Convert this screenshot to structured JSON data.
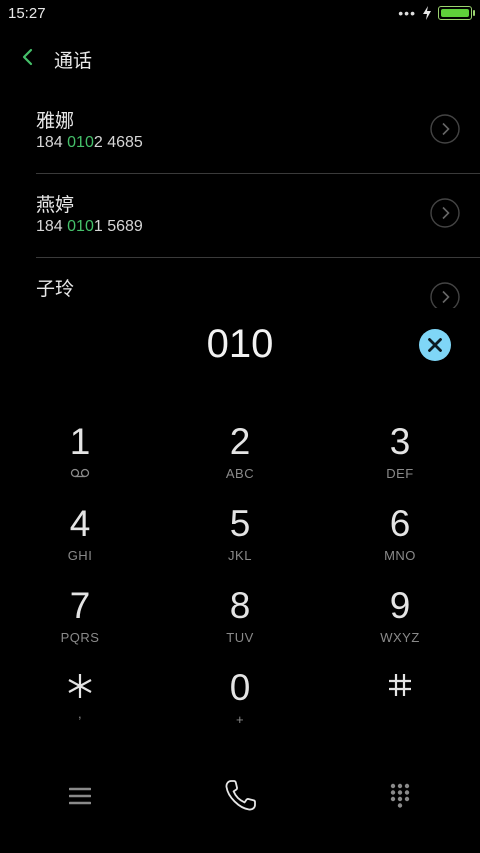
{
  "status_bar": {
    "time": "15:27",
    "dots": "•••",
    "battery_level": 1.0,
    "battery_color": "#5fd13a"
  },
  "header": {
    "title": "通话",
    "accent": "#45c06a"
  },
  "contacts": [
    {
      "name": "雅娜",
      "number_prefix": "184 ",
      "number_match": "010",
      "number_suffix": "2 4685"
    },
    {
      "name": "燕婷",
      "number_prefix": "184 ",
      "number_match": "010",
      "number_suffix": "1 5689"
    },
    {
      "name": "子玲",
      "number_prefix": "",
      "number_match": "",
      "number_suffix": ""
    }
  ],
  "dialer": {
    "entered": "010",
    "clear_button_color": "#7fd6f7"
  },
  "keypad": [
    {
      "digit": "1",
      "sub": "",
      "sub_icon": "voicemail-icon"
    },
    {
      "digit": "2",
      "sub": "ABC"
    },
    {
      "digit": "3",
      "sub": "DEF"
    },
    {
      "digit": "4",
      "sub": "GHI"
    },
    {
      "digit": "5",
      "sub": "JKL"
    },
    {
      "digit": "6",
      "sub": "MNO"
    },
    {
      "digit": "7",
      "sub": "PQRS"
    },
    {
      "digit": "8",
      "sub": "TUV"
    },
    {
      "digit": "9",
      "sub": "WXYZ"
    },
    {
      "digit": "*",
      "sub": ","
    },
    {
      "digit": "0",
      "sub": "+"
    },
    {
      "digit": "#",
      "sub": ""
    }
  ],
  "bottom_bar": {
    "left_icon": "menu-icon",
    "center_icon": "phone-call-icon",
    "right_icon": "dialpad-icon"
  }
}
